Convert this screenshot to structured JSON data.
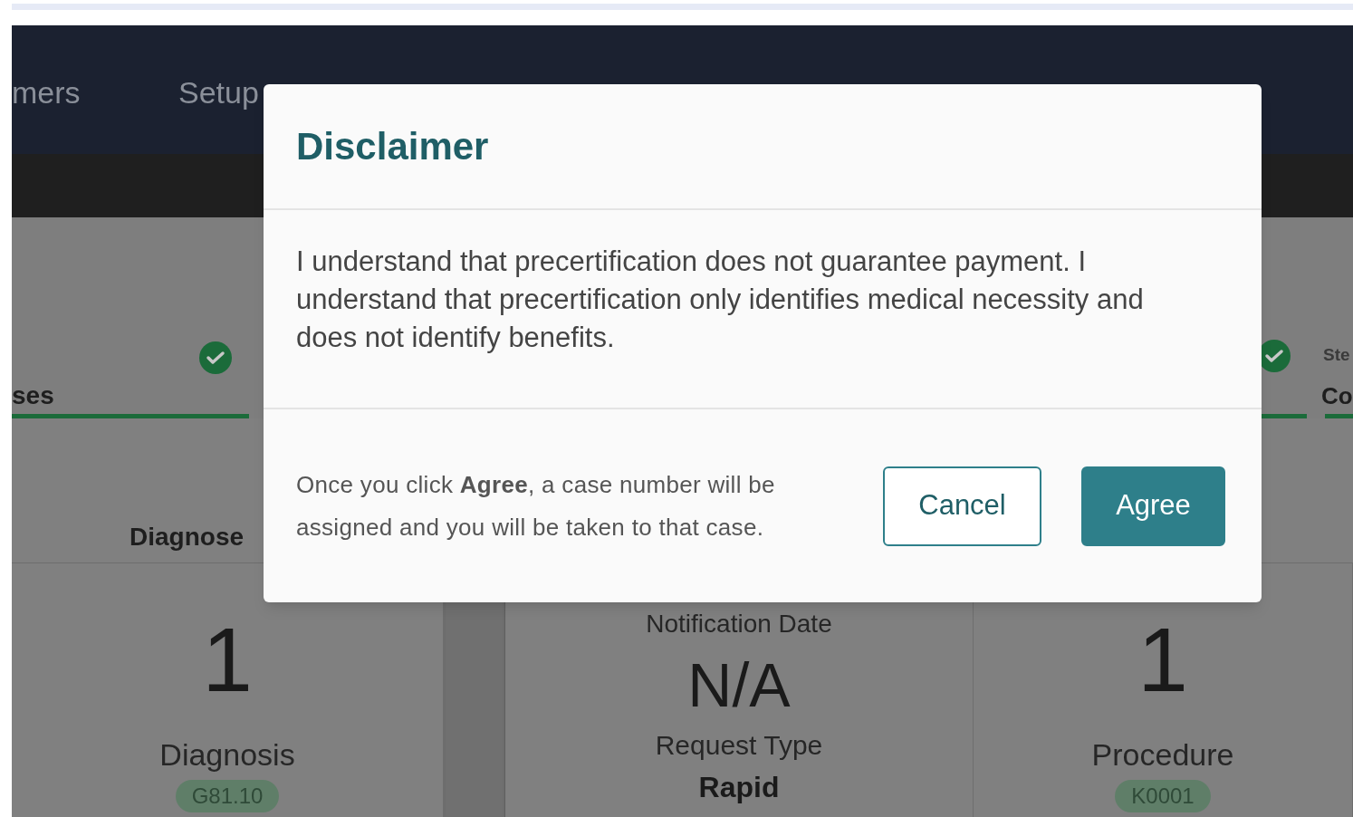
{
  "nav": [
    {
      "label": "mers"
    },
    {
      "label": "Setup"
    }
  ],
  "steps": [
    {
      "label": "ses",
      "complete": true
    },
    {
      "sublabel": "Ste",
      "label": "Co",
      "complete": true
    }
  ],
  "section_heading": "Diagnose",
  "cards": [
    {
      "kind": "count",
      "value": "1",
      "label": "Diagnosis",
      "code": "G81.10"
    },
    {
      "kind": "info",
      "caption": "Notification Date",
      "value": "N/A",
      "label": "Request Type",
      "detail": "Rapid"
    },
    {
      "kind": "count",
      "value": "1",
      "label": "Procedure",
      "code": "K0001"
    }
  ],
  "dialog": {
    "title": "Disclaimer",
    "body": "I understand that precertification does not guarantee payment. I understand that precertification only identifies medical necessity and does not identify benefits.",
    "note": "Once you click **Agree**, a case number will be assigned and you will be taken to that case.",
    "buttons": [
      {
        "label": "Cancel",
        "kind": "secondary"
      },
      {
        "label": "Agree",
        "kind": "primary"
      }
    ]
  }
}
